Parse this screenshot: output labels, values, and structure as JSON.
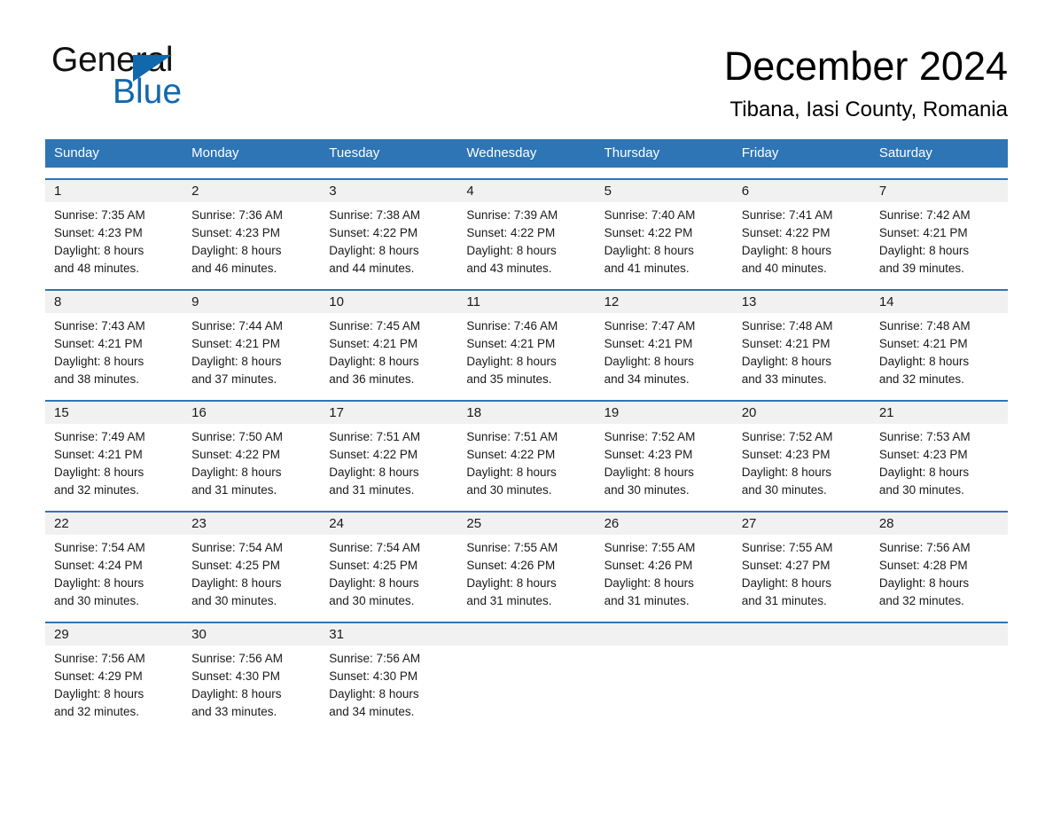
{
  "brand": {
    "name_part1": "General",
    "name_part2": "Blue",
    "accent_color": "#1068ad"
  },
  "header": {
    "title": "December 2024",
    "location": "Tibana, Iasi County, Romania",
    "header_bar_color": "#2e75b6"
  },
  "weekdays": [
    "Sunday",
    "Monday",
    "Tuesday",
    "Wednesday",
    "Thursday",
    "Friday",
    "Saturday"
  ],
  "weeks": [
    {
      "days": [
        {
          "num": "1",
          "sunrise": "Sunrise: 7:35 AM",
          "sunset": "Sunset: 4:23 PM",
          "daylight_line1": "Daylight: 8 hours",
          "daylight_line2": "and 48 minutes."
        },
        {
          "num": "2",
          "sunrise": "Sunrise: 7:36 AM",
          "sunset": "Sunset: 4:23 PM",
          "daylight_line1": "Daylight: 8 hours",
          "daylight_line2": "and 46 minutes."
        },
        {
          "num": "3",
          "sunrise": "Sunrise: 7:38 AM",
          "sunset": "Sunset: 4:22 PM",
          "daylight_line1": "Daylight: 8 hours",
          "daylight_line2": "and 44 minutes."
        },
        {
          "num": "4",
          "sunrise": "Sunrise: 7:39 AM",
          "sunset": "Sunset: 4:22 PM",
          "daylight_line1": "Daylight: 8 hours",
          "daylight_line2": "and 43 minutes."
        },
        {
          "num": "5",
          "sunrise": "Sunrise: 7:40 AM",
          "sunset": "Sunset: 4:22 PM",
          "daylight_line1": "Daylight: 8 hours",
          "daylight_line2": "and 41 minutes."
        },
        {
          "num": "6",
          "sunrise": "Sunrise: 7:41 AM",
          "sunset": "Sunset: 4:22 PM",
          "daylight_line1": "Daylight: 8 hours",
          "daylight_line2": "and 40 minutes."
        },
        {
          "num": "7",
          "sunrise": "Sunrise: 7:42 AM",
          "sunset": "Sunset: 4:21 PM",
          "daylight_line1": "Daylight: 8 hours",
          "daylight_line2": "and 39 minutes."
        }
      ]
    },
    {
      "days": [
        {
          "num": "8",
          "sunrise": "Sunrise: 7:43 AM",
          "sunset": "Sunset: 4:21 PM",
          "daylight_line1": "Daylight: 8 hours",
          "daylight_line2": "and 38 minutes."
        },
        {
          "num": "9",
          "sunrise": "Sunrise: 7:44 AM",
          "sunset": "Sunset: 4:21 PM",
          "daylight_line1": "Daylight: 8 hours",
          "daylight_line2": "and 37 minutes."
        },
        {
          "num": "10",
          "sunrise": "Sunrise: 7:45 AM",
          "sunset": "Sunset: 4:21 PM",
          "daylight_line1": "Daylight: 8 hours",
          "daylight_line2": "and 36 minutes."
        },
        {
          "num": "11",
          "sunrise": "Sunrise: 7:46 AM",
          "sunset": "Sunset: 4:21 PM",
          "daylight_line1": "Daylight: 8 hours",
          "daylight_line2": "and 35 minutes."
        },
        {
          "num": "12",
          "sunrise": "Sunrise: 7:47 AM",
          "sunset": "Sunset: 4:21 PM",
          "daylight_line1": "Daylight: 8 hours",
          "daylight_line2": "and 34 minutes."
        },
        {
          "num": "13",
          "sunrise": "Sunrise: 7:48 AM",
          "sunset": "Sunset: 4:21 PM",
          "daylight_line1": "Daylight: 8 hours",
          "daylight_line2": "and 33 minutes."
        },
        {
          "num": "14",
          "sunrise": "Sunrise: 7:48 AM",
          "sunset": "Sunset: 4:21 PM",
          "daylight_line1": "Daylight: 8 hours",
          "daylight_line2": "and 32 minutes."
        }
      ]
    },
    {
      "days": [
        {
          "num": "15",
          "sunrise": "Sunrise: 7:49 AM",
          "sunset": "Sunset: 4:21 PM",
          "daylight_line1": "Daylight: 8 hours",
          "daylight_line2": "and 32 minutes."
        },
        {
          "num": "16",
          "sunrise": "Sunrise: 7:50 AM",
          "sunset": "Sunset: 4:22 PM",
          "daylight_line1": "Daylight: 8 hours",
          "daylight_line2": "and 31 minutes."
        },
        {
          "num": "17",
          "sunrise": "Sunrise: 7:51 AM",
          "sunset": "Sunset: 4:22 PM",
          "daylight_line1": "Daylight: 8 hours",
          "daylight_line2": "and 31 minutes."
        },
        {
          "num": "18",
          "sunrise": "Sunrise: 7:51 AM",
          "sunset": "Sunset: 4:22 PM",
          "daylight_line1": "Daylight: 8 hours",
          "daylight_line2": "and 30 minutes."
        },
        {
          "num": "19",
          "sunrise": "Sunrise: 7:52 AM",
          "sunset": "Sunset: 4:23 PM",
          "daylight_line1": "Daylight: 8 hours",
          "daylight_line2": "and 30 minutes."
        },
        {
          "num": "20",
          "sunrise": "Sunrise: 7:52 AM",
          "sunset": "Sunset: 4:23 PM",
          "daylight_line1": "Daylight: 8 hours",
          "daylight_line2": "and 30 minutes."
        },
        {
          "num": "21",
          "sunrise": "Sunrise: 7:53 AM",
          "sunset": "Sunset: 4:23 PM",
          "daylight_line1": "Daylight: 8 hours",
          "daylight_line2": "and 30 minutes."
        }
      ]
    },
    {
      "days": [
        {
          "num": "22",
          "sunrise": "Sunrise: 7:54 AM",
          "sunset": "Sunset: 4:24 PM",
          "daylight_line1": "Daylight: 8 hours",
          "daylight_line2": "and 30 minutes."
        },
        {
          "num": "23",
          "sunrise": "Sunrise: 7:54 AM",
          "sunset": "Sunset: 4:25 PM",
          "daylight_line1": "Daylight: 8 hours",
          "daylight_line2": "and 30 minutes."
        },
        {
          "num": "24",
          "sunrise": "Sunrise: 7:54 AM",
          "sunset": "Sunset: 4:25 PM",
          "daylight_line1": "Daylight: 8 hours",
          "daylight_line2": "and 30 minutes."
        },
        {
          "num": "25",
          "sunrise": "Sunrise: 7:55 AM",
          "sunset": "Sunset: 4:26 PM",
          "daylight_line1": "Daylight: 8 hours",
          "daylight_line2": "and 31 minutes."
        },
        {
          "num": "26",
          "sunrise": "Sunrise: 7:55 AM",
          "sunset": "Sunset: 4:26 PM",
          "daylight_line1": "Daylight: 8 hours",
          "daylight_line2": "and 31 minutes."
        },
        {
          "num": "27",
          "sunrise": "Sunrise: 7:55 AM",
          "sunset": "Sunset: 4:27 PM",
          "daylight_line1": "Daylight: 8 hours",
          "daylight_line2": "and 31 minutes."
        },
        {
          "num": "28",
          "sunrise": "Sunrise: 7:56 AM",
          "sunset": "Sunset: 4:28 PM",
          "daylight_line1": "Daylight: 8 hours",
          "daylight_line2": "and 32 minutes."
        }
      ]
    },
    {
      "days": [
        {
          "num": "29",
          "sunrise": "Sunrise: 7:56 AM",
          "sunset": "Sunset: 4:29 PM",
          "daylight_line1": "Daylight: 8 hours",
          "daylight_line2": "and 32 minutes."
        },
        {
          "num": "30",
          "sunrise": "Sunrise: 7:56 AM",
          "sunset": "Sunset: 4:30 PM",
          "daylight_line1": "Daylight: 8 hours",
          "daylight_line2": "and 33 minutes."
        },
        {
          "num": "31",
          "sunrise": "Sunrise: 7:56 AM",
          "sunset": "Sunset: 4:30 PM",
          "daylight_line1": "Daylight: 8 hours",
          "daylight_line2": "and 34 minutes."
        },
        {
          "num": "",
          "sunrise": "",
          "sunset": "",
          "daylight_line1": "",
          "daylight_line2": ""
        },
        {
          "num": "",
          "sunrise": "",
          "sunset": "",
          "daylight_line1": "",
          "daylight_line2": ""
        },
        {
          "num": "",
          "sunrise": "",
          "sunset": "",
          "daylight_line1": "",
          "daylight_line2": ""
        },
        {
          "num": "",
          "sunrise": "",
          "sunset": "",
          "daylight_line1": "",
          "daylight_line2": ""
        }
      ]
    }
  ]
}
